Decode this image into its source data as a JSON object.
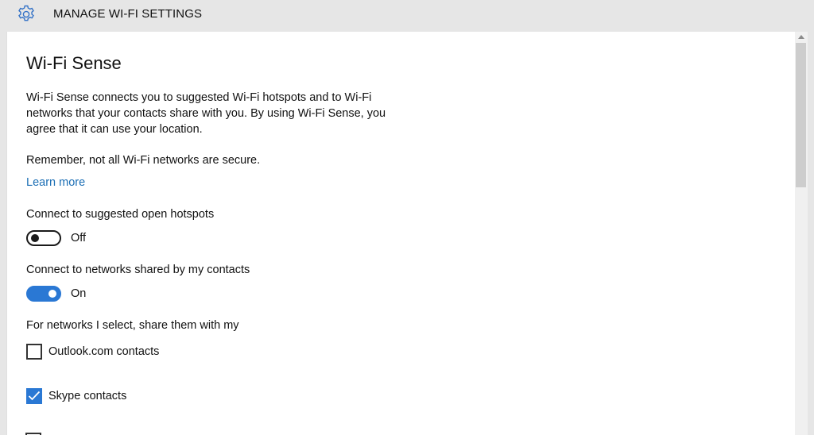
{
  "header": {
    "title": "MANAGE WI-FI SETTINGS",
    "icon": "gear-icon",
    "icon_color": "#3573c7"
  },
  "main": {
    "title": "Wi-Fi Sense",
    "description": "Wi-Fi Sense connects you to suggested Wi-Fi hotspots and to Wi-Fi networks that your contacts share with you. By using Wi-Fi Sense, you agree that it can use your location.",
    "reminder": "Remember, not all Wi-Fi networks are secure.",
    "learn_more": "Learn more",
    "link_color": "#1c6fb5",
    "open_hotspots": {
      "label": "Connect to suggested open hotspots",
      "state_label": "Off",
      "enabled": false
    },
    "shared_networks": {
      "label": "Connect to networks shared by my contacts",
      "state_label": "On",
      "enabled": true
    },
    "share_with_label": "For networks I select, share them with my",
    "share_options": [
      {
        "label": "Outlook.com contacts",
        "checked": false
      },
      {
        "label": "Skype contacts",
        "checked": true
      }
    ],
    "accent_color": "#2a78d4"
  }
}
